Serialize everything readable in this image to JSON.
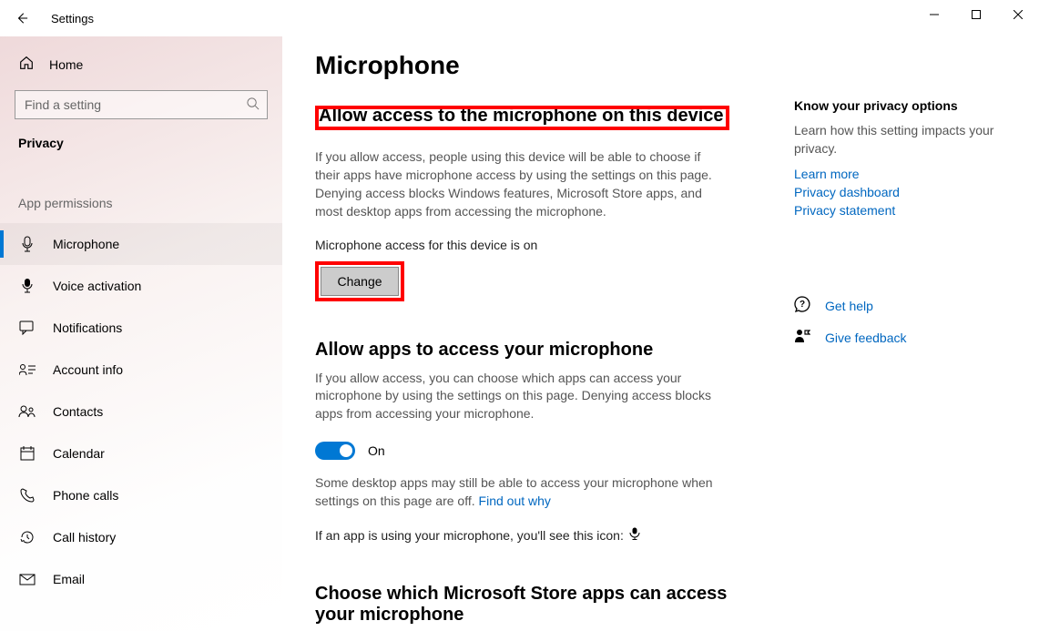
{
  "window": {
    "title": "Settings"
  },
  "sidebar": {
    "home": "Home",
    "search_placeholder": "Find a setting",
    "category": "Privacy",
    "group": "App permissions",
    "items": [
      {
        "label": "Microphone"
      },
      {
        "label": "Voice activation"
      },
      {
        "label": "Notifications"
      },
      {
        "label": "Account info"
      },
      {
        "label": "Contacts"
      },
      {
        "label": "Calendar"
      },
      {
        "label": "Phone calls"
      },
      {
        "label": "Call history"
      },
      {
        "label": "Email"
      }
    ]
  },
  "main": {
    "page_title": "Microphone",
    "s1_heading": "Allow access to the microphone on this device",
    "s1_body": "If you allow access, people using this device will be able to choose if their apps have microphone access by using the settings on this page. Denying access blocks Windows features, Microsoft Store apps, and most desktop apps from accessing the microphone.",
    "s1_status": "Microphone access for this device is on",
    "change_btn": "Change",
    "s2_heading": "Allow apps to access your microphone",
    "s2_body": "If you allow access, you can choose which apps can access your microphone by using the settings on this page. Denying access blocks apps from accessing your microphone.",
    "toggle_label": "On",
    "s2_note_a": "Some desktop apps may still be able to access your microphone when settings on this page are off. ",
    "s2_note_link": "Find out why",
    "s2_note_b": "If an app is using your microphone, you'll see this icon:",
    "s3_heading": "Choose which Microsoft Store apps can access your microphone"
  },
  "aside": {
    "heading": "Know your privacy options",
    "body": "Learn how this setting impacts your privacy.",
    "links": [
      "Learn more",
      "Privacy dashboard",
      "Privacy statement"
    ],
    "help": "Get help",
    "feedback": "Give feedback"
  }
}
